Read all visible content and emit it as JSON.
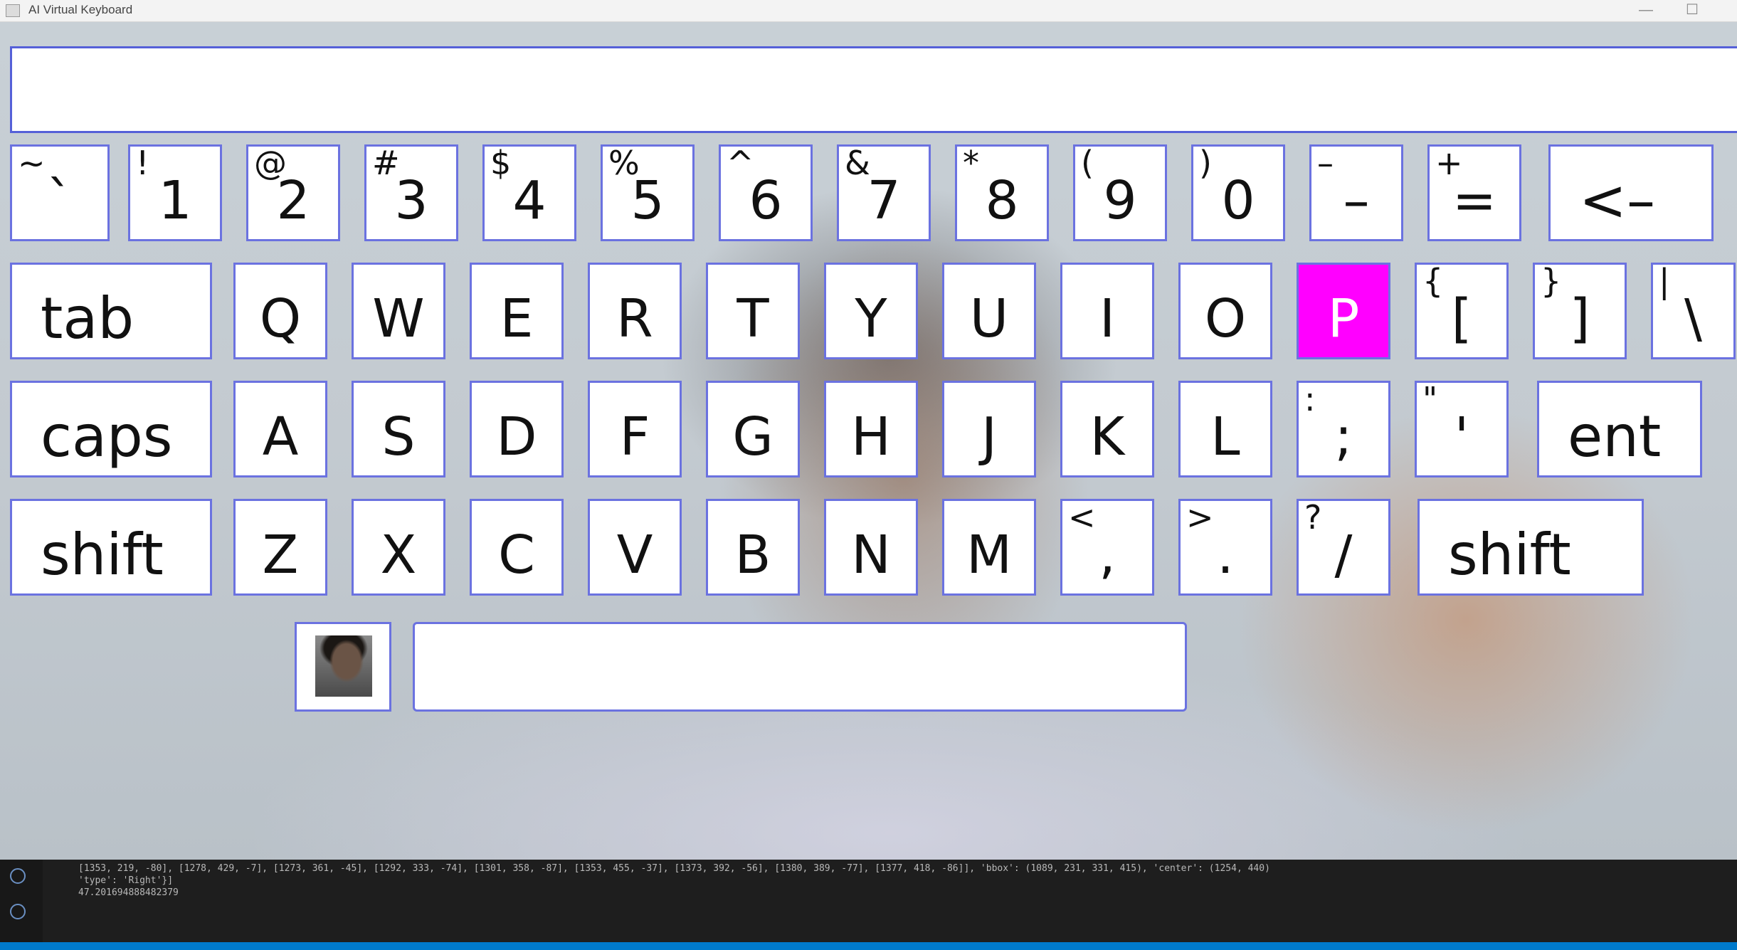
{
  "window": {
    "title": "AI Virtual Keyboard",
    "minimize_glyph": "—",
    "maximize_glyph": "☐"
  },
  "keyboard": {
    "text_field_value": "",
    "highlighted_key": "P",
    "rows": [
      [
        {
          "name": "key-backtick",
          "main": "`",
          "shift": "~"
        },
        {
          "name": "key-1",
          "main": "1",
          "shift": "!"
        },
        {
          "name": "key-2",
          "main": "2",
          "shift": "@"
        },
        {
          "name": "key-3",
          "main": "3",
          "shift": "#"
        },
        {
          "name": "key-4",
          "main": "4",
          "shift": "$"
        },
        {
          "name": "key-5",
          "main": "5",
          "shift": "%"
        },
        {
          "name": "key-6",
          "main": "6",
          "shift": "^"
        },
        {
          "name": "key-7",
          "main": "7",
          "shift": "&"
        },
        {
          "name": "key-8",
          "main": "8",
          "shift": "*"
        },
        {
          "name": "key-9",
          "main": "9",
          "shift": "("
        },
        {
          "name": "key-0",
          "main": "0",
          "shift": ")"
        },
        {
          "name": "key-minus",
          "main": "–",
          "shift": "–"
        },
        {
          "name": "key-equals",
          "main": "=",
          "shift": "+"
        },
        {
          "name": "key-backspace",
          "main": "<–",
          "shift": ""
        }
      ],
      [
        {
          "name": "key-tab",
          "main": "tab",
          "shift": ""
        },
        {
          "name": "key-q",
          "main": "Q",
          "shift": ""
        },
        {
          "name": "key-w",
          "main": "W",
          "shift": ""
        },
        {
          "name": "key-e",
          "main": "E",
          "shift": ""
        },
        {
          "name": "key-r",
          "main": "R",
          "shift": ""
        },
        {
          "name": "key-t",
          "main": "T",
          "shift": ""
        },
        {
          "name": "key-y",
          "main": "Y",
          "shift": ""
        },
        {
          "name": "key-u",
          "main": "U",
          "shift": ""
        },
        {
          "name": "key-i",
          "main": "I",
          "shift": ""
        },
        {
          "name": "key-o",
          "main": "O",
          "shift": ""
        },
        {
          "name": "key-p",
          "main": "P",
          "shift": ""
        },
        {
          "name": "key-left-bracket",
          "main": "[",
          "shift": "{"
        },
        {
          "name": "key-right-bracket",
          "main": "]",
          "shift": "}"
        },
        {
          "name": "key-backslash",
          "main": "\\",
          "shift": "|"
        }
      ],
      [
        {
          "name": "key-caps",
          "main": "caps",
          "shift": ""
        },
        {
          "name": "key-a",
          "main": "A",
          "shift": ""
        },
        {
          "name": "key-s",
          "main": "S",
          "shift": ""
        },
        {
          "name": "key-d",
          "main": "D",
          "shift": ""
        },
        {
          "name": "key-f",
          "main": "F",
          "shift": ""
        },
        {
          "name": "key-g",
          "main": "G",
          "shift": ""
        },
        {
          "name": "key-h",
          "main": "H",
          "shift": ""
        },
        {
          "name": "key-j",
          "main": "J",
          "shift": ""
        },
        {
          "name": "key-k",
          "main": "K",
          "shift": ""
        },
        {
          "name": "key-l",
          "main": "L",
          "shift": ""
        },
        {
          "name": "key-semicolon",
          "main": ";",
          "shift": ":"
        },
        {
          "name": "key-quote",
          "main": "'",
          "shift": "\""
        },
        {
          "name": "key-enter",
          "main": "ent",
          "shift": ""
        }
      ],
      [
        {
          "name": "key-shift-left",
          "main": "shift",
          "shift": ""
        },
        {
          "name": "key-z",
          "main": "Z",
          "shift": ""
        },
        {
          "name": "key-x",
          "main": "X",
          "shift": ""
        },
        {
          "name": "key-c",
          "main": "C",
          "shift": ""
        },
        {
          "name": "key-v",
          "main": "V",
          "shift": ""
        },
        {
          "name": "key-b",
          "main": "B",
          "shift": ""
        },
        {
          "name": "key-n",
          "main": "N",
          "shift": ""
        },
        {
          "name": "key-m",
          "main": "M",
          "shift": ""
        },
        {
          "name": "key-comma",
          "main": ",",
          "shift": "<"
        },
        {
          "name": "key-period",
          "main": ".",
          "shift": ">"
        },
        {
          "name": "key-slash",
          "main": "/",
          "shift": "?"
        },
        {
          "name": "key-shift-right",
          "main": "shift",
          "shift": ""
        }
      ]
    ],
    "space_bar_value": ""
  },
  "terminal": {
    "lines": [
      "[1353, 219, -80], [1278, 429, -7], [1273, 361, -45], [1292, 333, -74], [1301, 358, -87], [1353, 455, -37], [1373, 392, -56], [1380, 389, -77], [1377, 418, -86]], 'bbox': (1089, 231, 331, 415), 'center': (1254, 440)",
      "'type': 'Right'}]",
      "47.201694888482379"
    ]
  },
  "colors": {
    "key_border": "#6b72e0",
    "highlight": "#ff00ff",
    "statusbar": "#007acc"
  }
}
